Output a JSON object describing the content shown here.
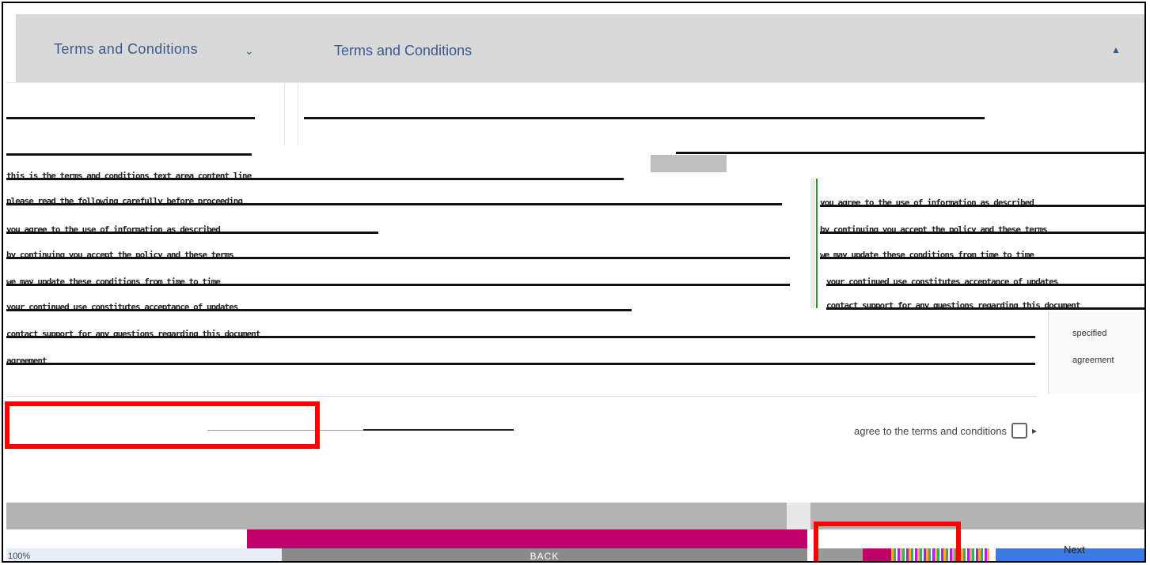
{
  "header": {
    "title_left": "Terms and Conditions",
    "chevron_icon": "chevron-down-icon",
    "title_right": "Terms and Conditions",
    "caret_icon": "caret-up-icon"
  },
  "body_lines": [
    "this is the terms and conditions text area content line",
    "please read the following carefully before proceeding",
    "you agree to the use of information as described",
    "by continuing you accept the policy and these terms",
    "we may update these conditions from time to time",
    "your continued use constitutes acceptance of updates",
    "contact support for any questions regarding this document",
    "agreement"
  ],
  "side_panel": {
    "line1": "specified",
    "line2": "agreement"
  },
  "agree": {
    "label": "agree to the terms and conditions",
    "checked": false
  },
  "footer": {
    "back_label": "BACK",
    "next_label": "Next",
    "left_label": "100%"
  },
  "colors": {
    "accent": "#3a5a8c",
    "magenta": "#c0006a",
    "highlight": "#ff0000"
  }
}
